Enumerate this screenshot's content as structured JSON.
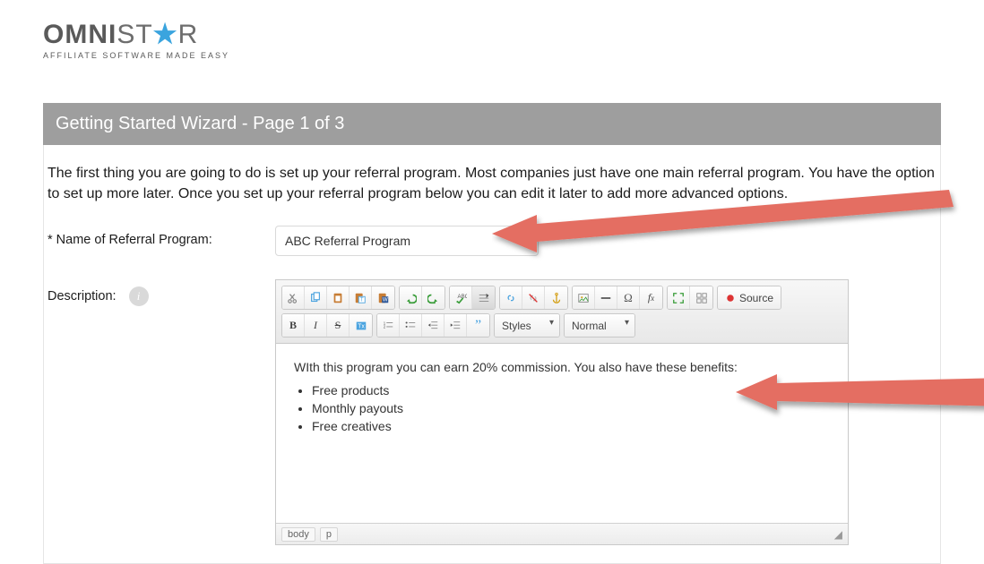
{
  "logo": {
    "pre": "OMNI",
    "mid": "ST",
    "star": "★",
    "post": "R",
    "tagline": "AFFILIATE SOFTWARE MADE EASY"
  },
  "titlebar": "Getting Started Wizard - Page 1 of 3",
  "intro": "The first thing you are going to do is set up your referral program. Most companies just have one main referral program. You have the option to set up more later. Once you set up your referral program below you can edit it later to add more advanced options.",
  "fields": {
    "name": {
      "label": "* Name of Referral Program:",
      "value": "ABC Referral Program"
    },
    "description": {
      "label": "Description:"
    }
  },
  "editor": {
    "styles_select": "Styles",
    "format_select": "Normal",
    "source_label": "Source",
    "content_p": "WIth this program you can earn 20% commission. You also have these benefits:",
    "content_li": [
      "Free products",
      "Monthly payouts",
      "Free creatives"
    ],
    "status_path": [
      "body",
      "p"
    ]
  },
  "icons": {
    "info": "i",
    "cut": "cut",
    "copy": "copy",
    "paste": "paste",
    "paste_text": "paste-text",
    "paste_word": "paste-word",
    "undo": "undo",
    "redo": "redo",
    "spell": "spell",
    "spell_opts": "spell-opts",
    "link": "link",
    "unlink": "unlink",
    "anchor": "anchor",
    "image": "image",
    "hr": "hr",
    "special": "special",
    "fx": "fx",
    "maximize": "maximize",
    "blocks": "blocks",
    "bold": "B",
    "italic": "I",
    "strike": "S",
    "removefmt": "removefmt",
    "ol": "ol",
    "ul": "ul",
    "outdent": "outdent",
    "indent": "indent",
    "quote": "quote"
  }
}
